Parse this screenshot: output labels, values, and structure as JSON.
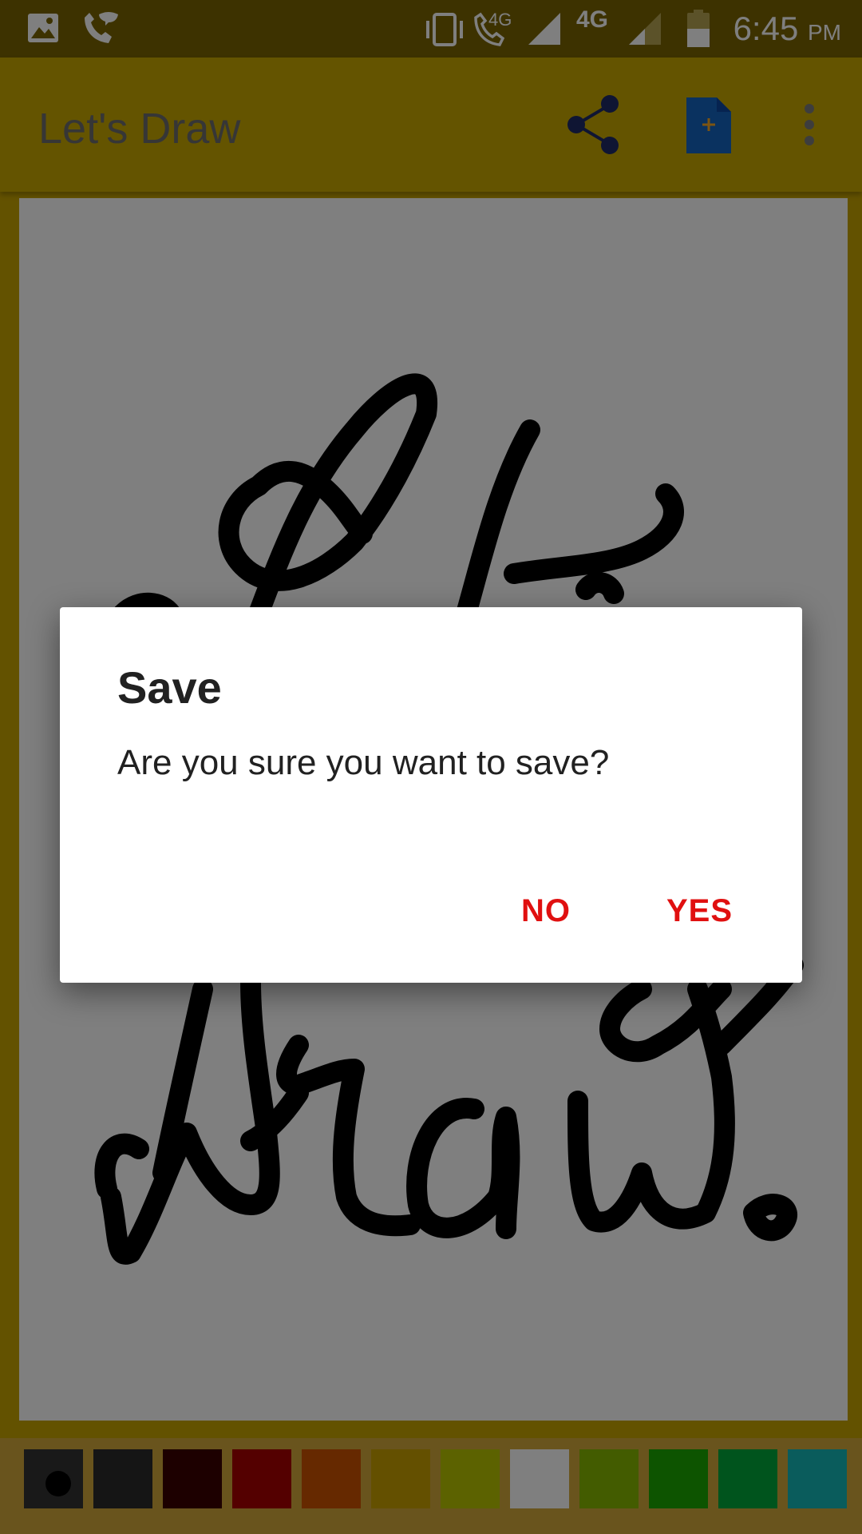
{
  "status_bar": {
    "time": "6:45",
    "ampm": "PM",
    "net_small": "4G",
    "net_large": "4G",
    "icons": [
      "gallery-icon",
      "wifi-calling-icon",
      "vibrate-icon",
      "volte-call-icon",
      "signal-icon",
      "signal-weak-icon",
      "battery-icon"
    ]
  },
  "app_bar": {
    "title": "Let's Draw",
    "actions": [
      "share-icon",
      "new-file-icon",
      "more-options-icon"
    ]
  },
  "dialog": {
    "title": "Save",
    "message": "Are you sure you want to save?",
    "negative": "NO",
    "positive": "YES",
    "button_color": "#e01010"
  },
  "palette": {
    "selected_index": 0,
    "colors": [
      "#333333",
      "#2b2b2b",
      "#3a0000",
      "#a80000",
      "#cc5200",
      "#c9a000",
      "#b8c400",
      "#ffffff",
      "#86b800",
      "#1ba800",
      "#00a83a",
      "#14b8b8"
    ]
  }
}
